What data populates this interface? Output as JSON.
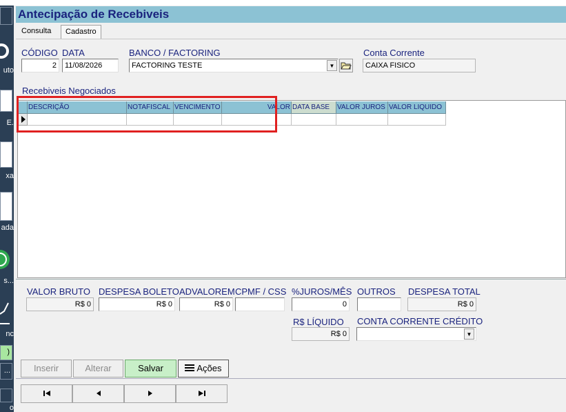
{
  "sidebar": {
    "labels": [
      "uto",
      "E.",
      "xa",
      "ada",
      "s...",
      "nc",
      ")",
      "...",
      "o"
    ]
  },
  "window": {
    "title": "Antecipação de Recebiveis"
  },
  "tabs": [
    {
      "label": "Consulta"
    },
    {
      "label": "Cadastro"
    }
  ],
  "form": {
    "codigo_label": "CÓDIGO",
    "codigo_value": "2",
    "data_label": "DATA",
    "data_value": "11/08/2026",
    "banco_label": "BANCO / FACTORING",
    "banco_value": "FACTORING TESTE",
    "conta_label": "Conta Corrente",
    "conta_value": "CAIXA FISICO"
  },
  "grid": {
    "title": "Recebiveis Negociados",
    "columns": [
      "DESCRIÇÃO",
      "NOTAFISCAL",
      "VENCIMENTO",
      "VALOR",
      "DATA BASE",
      "VALOR JUROS",
      "VALOR LIQUIDO"
    ]
  },
  "totals": {
    "valor_bruto_label": "VALOR BRUTO",
    "valor_bruto_value": "R$ 0",
    "despesa_boleto_label": "DESPESA BOLETO",
    "despesa_boleto_value": "R$ 0",
    "advalorem_label": "ADVALOREM",
    "advalorem_value": "R$ 0",
    "cpmf_label": "CPMF / CSS",
    "cpmf_value": "",
    "juros_label": "%JUROS/MÊS",
    "juros_value": "0",
    "outros_label": "OUTROS",
    "outros_value": "",
    "despesa_total_label": "DESPESA TOTAL",
    "despesa_total_value": "R$ 0",
    "liquido_label": "R$ LÍQUIDO",
    "liquido_value": "R$ 0",
    "conta_credito_label": "CONTA CORRENTE CRÉDITO",
    "conta_credito_value": ""
  },
  "buttons": {
    "inserir": "Inserir",
    "alterar": "Alterar",
    "salvar": "Salvar",
    "acoes": "Ações"
  },
  "nav": {
    "first": "▶|",
    "prev": "◀",
    "next": "▶",
    "last": "▶|"
  },
  "colors": {
    "title_bg": "#8cc2d4",
    "label": "#1a237e",
    "highlight": "#e02020",
    "save_bg": "#c8efc8"
  }
}
